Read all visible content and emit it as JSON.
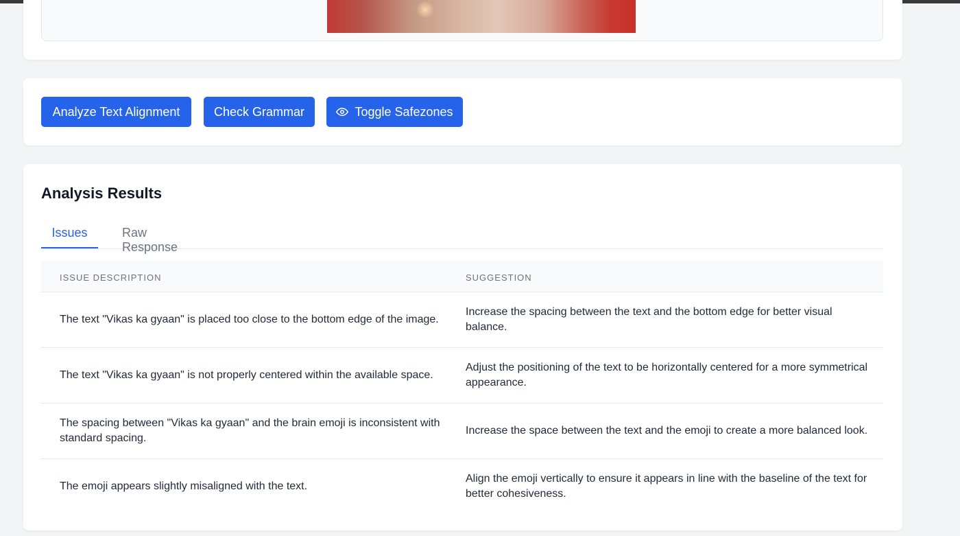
{
  "actions": {
    "analyze_label": "Analyze Text Alignment",
    "grammar_label": "Check Grammar",
    "safezones_label": "Toggle Safezones"
  },
  "icons": {
    "safezones": "eye-icon"
  },
  "colors": {
    "primary": "#2563eb",
    "background": "#f3f4f6",
    "card": "#ffffff"
  },
  "results": {
    "title": "Analysis Results",
    "tabs": [
      {
        "label": "Issues",
        "active": true
      },
      {
        "label": "Raw Response",
        "active": false
      }
    ],
    "columns": [
      "Issue Description",
      "Suggestion"
    ],
    "rows": [
      {
        "issue": "The text \"Vikas ka gyaan\" is placed too close to the bottom edge of the image.",
        "suggestion": "Increase the spacing between the text and the bottom edge for better visual balance."
      },
      {
        "issue": "The text \"Vikas ka gyaan\" is not properly centered within the available space.",
        "suggestion": "Adjust the positioning of the text to be horizontally centered for a more symmetrical appearance."
      },
      {
        "issue": "The spacing between \"Vikas ka gyaan\" and the brain emoji is inconsistent with standard spacing.",
        "suggestion": "Increase the space between the text and the emoji to create a more balanced look."
      },
      {
        "issue": "The emoji appears slightly misaligned with the text.",
        "suggestion": "Align the emoji vertically to ensure it appears in line with the baseline of the text for better cohesiveness."
      }
    ]
  }
}
